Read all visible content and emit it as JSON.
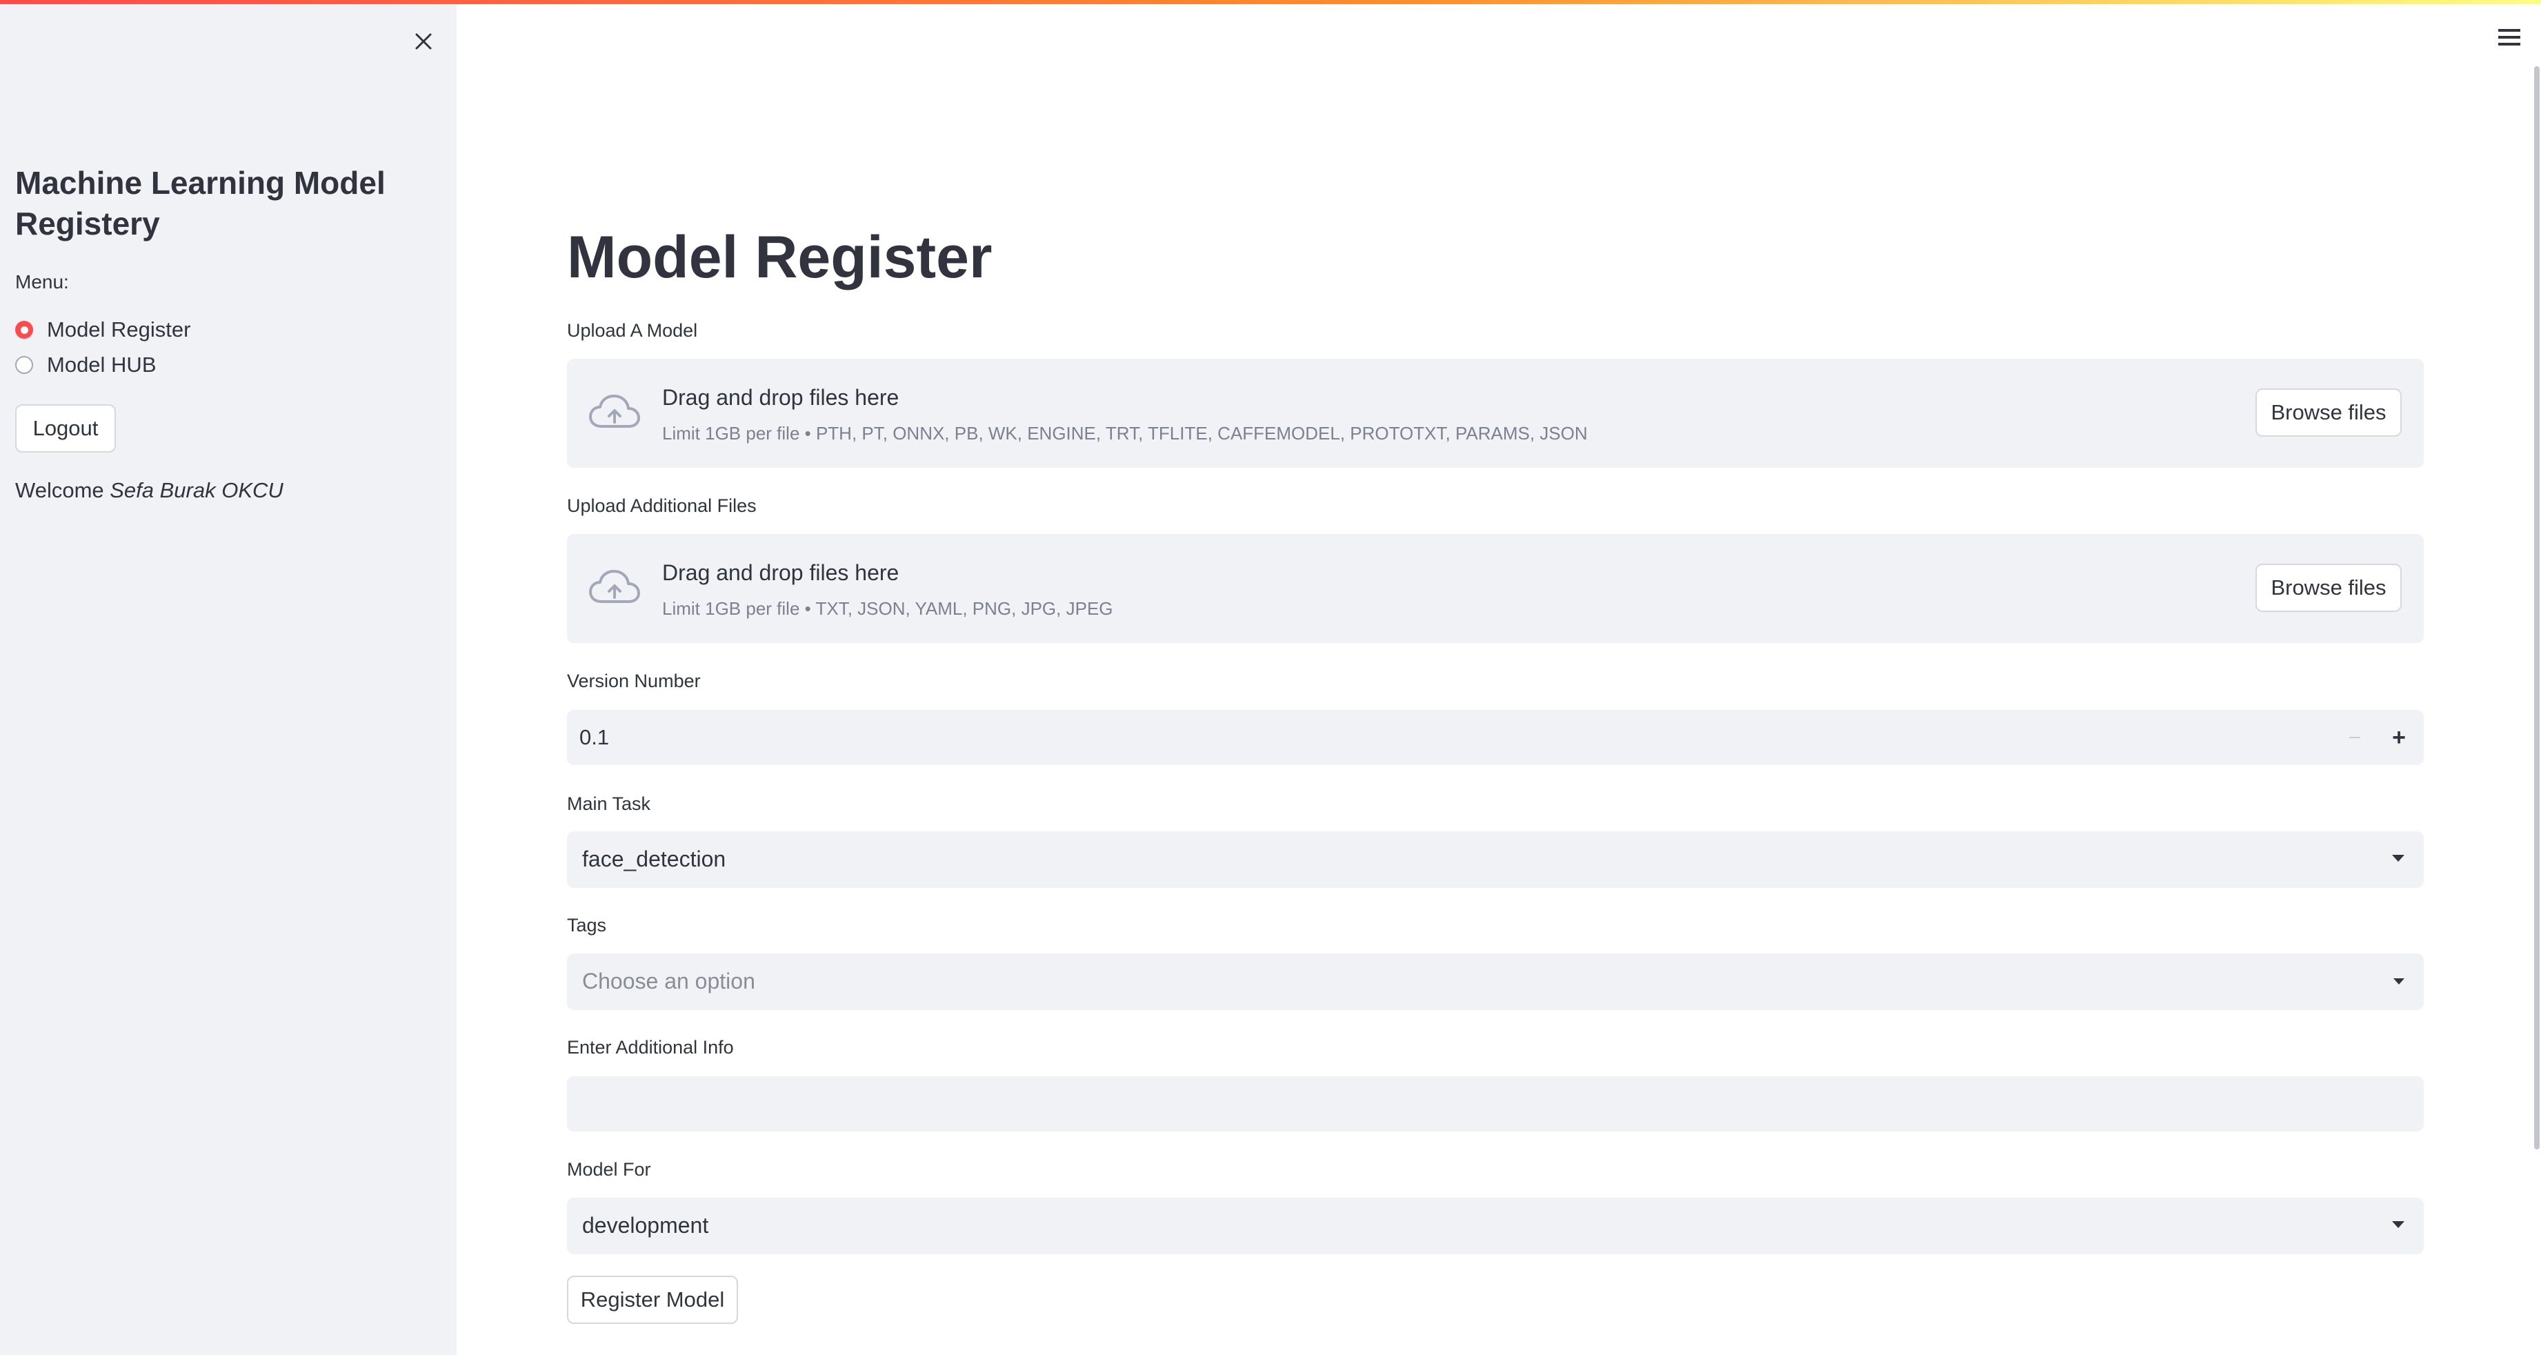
{
  "sidebar": {
    "title": "Machine Learning Model Registery",
    "menu_label": "Menu:",
    "menu_items": [
      {
        "label": "Model Register",
        "selected": true
      },
      {
        "label": "Model HUB",
        "selected": false
      }
    ],
    "logout_label": "Logout",
    "welcome_prefix": "Welcome ",
    "user_name": "Sefa Burak OKCU",
    "close_icon": "close-icon"
  },
  "header": {
    "menu_icon": "hamburger-icon"
  },
  "main": {
    "title": "Model Register",
    "upload_model": {
      "label": "Upload A Model",
      "drop_text": "Drag and drop files here",
      "limit_text": "Limit 1GB per file • PTH, PT, ONNX, PB, WK, ENGINE, TRT, TFLITE, CAFFEMODEL, PROTOTXT, PARAMS, JSON",
      "browse_label": "Browse files",
      "icon": "cloud-upload-icon"
    },
    "upload_additional": {
      "label": "Upload Additional Files",
      "drop_text": "Drag and drop files here",
      "limit_text": "Limit 1GB per file • TXT, JSON, YAML, PNG, JPG, JPEG",
      "browse_label": "Browse files",
      "icon": "cloud-upload-icon"
    },
    "version": {
      "label": "Version Number",
      "value": "0.1",
      "minus": "−",
      "plus": "+"
    },
    "main_task": {
      "label": "Main Task",
      "value": "face_detection"
    },
    "tags": {
      "label": "Tags",
      "placeholder": "Choose an option"
    },
    "additional_info": {
      "label": "Enter Additional Info",
      "value": ""
    },
    "model_for": {
      "label": "Model For",
      "value": "development"
    },
    "register_label": "Register Model"
  },
  "colors": {
    "accent": "#ff4b4b",
    "sidebar_bg": "#f0f2f6",
    "field_bg": "#f0f2f6",
    "text": "#31333f",
    "muted_text": "#7d8090"
  }
}
